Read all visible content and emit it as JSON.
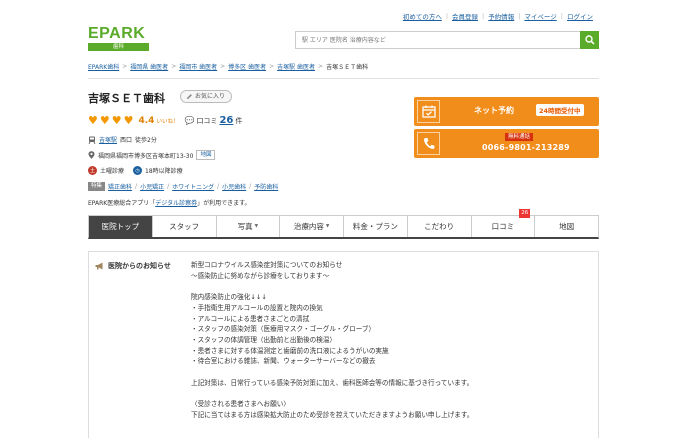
{
  "brand": {
    "logo_text": "EPARK",
    "logo_sub": "歯科",
    "accent": "#5aab2a",
    "orange": "#f18d1b"
  },
  "top_links": [
    "初めての方へ",
    "会員登録",
    "予約情報",
    "マイページ",
    "ログイン"
  ],
  "search": {
    "placeholder": "駅 エリア 医院名 治療内容など",
    "icon": "search-icon"
  },
  "breadcrumb": [
    "EPARK歯科",
    "福岡県 歯医者",
    "福岡市 歯医者",
    "博多区 歯医者",
    "吉塚駅 歯医者",
    "吉塚ＳＥＴ歯科"
  ],
  "clinic": {
    "name": "吉塚ＳＥＴ歯科",
    "favorite_label": "お気に入り",
    "rating": {
      "hearts": 4,
      "score": "4.4",
      "iine_label": "いいね！",
      "review_label": "口コミ",
      "review_count": "26",
      "review_unit": "件"
    },
    "access": {
      "station": "吉塚駅",
      "exit": "西口",
      "walk": "徒歩2分"
    },
    "address": "福岡県福岡市博多区吉塚本町13-30",
    "map_label": "地図",
    "hours": {
      "sat": "土曜診療",
      "late": "18時以降診療"
    },
    "features_tag": "特集",
    "features": [
      "矯正歯科",
      "小児矯正",
      "ホワイトニング",
      "小児歯科",
      "予防歯科"
    ],
    "epark_note_pre": "EPARK医療総合アプリ「",
    "epark_note_link": "デジタル診察券",
    "epark_note_post": "」が利用できます。"
  },
  "cta": {
    "net_label": "ネット予約",
    "net_badge": "24時間受付中",
    "free_tag": "無料通話",
    "tel": "0066-9801-213289"
  },
  "tabs": [
    {
      "label": "医院トップ",
      "active": true,
      "caret": false
    },
    {
      "label": "スタッフ",
      "active": false,
      "caret": false
    },
    {
      "label": "写真",
      "active": false,
      "caret": true
    },
    {
      "label": "治療内容",
      "active": false,
      "caret": true
    },
    {
      "label": "料金・プラン",
      "active": false,
      "caret": false
    },
    {
      "label": "こだわり",
      "active": false,
      "caret": false
    },
    {
      "label": "口コミ",
      "active": false,
      "caret": false,
      "count": "26"
    },
    {
      "label": "地図",
      "active": false,
      "caret": false
    }
  ],
  "notice": {
    "title": "医院からのお知らせ",
    "lines": [
      "新型コロナウイルス感染症対策についてのお知らせ",
      "～感染防止に努めながら診療をしております～",
      "",
      "院内感染防止の強化↓↓↓",
      "・手指衛生用アルコールの設置と院内の換気",
      "・アルコールによる患者さまごとの清拭",
      "・スタッフの感染対策（医療用マスク・ゴーグル・グローブ）",
      "・スタッフの体調管理（出勤前と出勤後の検温）",
      "・患者さまに対する体温測定と歯磨前の洗口液によるうがいの実施",
      "・待合室における雑誌、新聞、ウォーターサーバーなどの撤去",
      "",
      "上記対策は、日常行っている感染予防対策に加え、歯科医師会等の情報に基づき行っています。",
      "",
      "〈受診される患者さまへお願い〉",
      "下記に当てはまる方は感染拡大防止のため受診を控えていただきますようお願い申し上げます。"
    ]
  }
}
